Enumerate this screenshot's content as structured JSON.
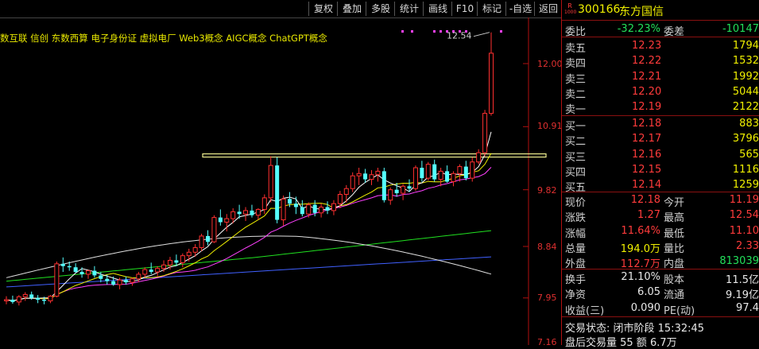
{
  "toolbar": {
    "buttons": [
      "复权",
      "叠加",
      "多股",
      "统计",
      "画线",
      "F10",
      "标记",
      "-自选",
      "返回"
    ]
  },
  "chart": {
    "concept_tags": "数互联 信创 东数西算 电子身份证 虚拟电厂 Web3概念 AIGC概念 ChatGPT概念",
    "high_marker": "12.54",
    "y_axis_labels": [
      "12.00",
      "10.91",
      "9.82",
      "8.84",
      "7.95",
      "7.16"
    ],
    "colors": {
      "up": "#ff3030",
      "down": "#54ffff",
      "ma5": "#ffffff",
      "ma10": "#f0f000",
      "ma20": "#ff40ff",
      "ma60": "#20e020",
      "ma120": "#4060ff",
      "ma250": "#e0e0e0",
      "hline": "#f0f090"
    },
    "candles": [
      [
        7.9,
        7.98,
        7.84,
        7.92
      ],
      [
        7.92,
        7.99,
        7.85,
        7.88
      ],
      [
        7.88,
        8.0,
        7.82,
        7.97
      ],
      [
        7.97,
        8.05,
        7.9,
        8.01
      ],
      [
        8.01,
        8.06,
        7.92,
        7.95
      ],
      [
        7.95,
        8.0,
        7.86,
        7.92
      ],
      [
        7.92,
        7.97,
        7.84,
        7.9
      ],
      [
        7.9,
        8.0,
        7.86,
        7.98
      ],
      [
        7.98,
        8.58,
        7.96,
        8.54
      ],
      [
        8.54,
        8.65,
        8.4,
        8.5
      ],
      [
        8.5,
        8.58,
        8.42,
        8.48
      ],
      [
        8.48,
        8.55,
        8.38,
        8.4
      ],
      [
        8.4,
        8.48,
        8.3,
        8.36
      ],
      [
        8.36,
        8.44,
        8.28,
        8.42
      ],
      [
        8.42,
        8.5,
        8.3,
        8.34
      ],
      [
        8.34,
        8.4,
        8.22,
        8.28
      ],
      [
        8.28,
        8.35,
        8.18,
        8.24
      ],
      [
        8.24,
        8.32,
        8.16,
        8.18
      ],
      [
        8.18,
        8.3,
        8.1,
        8.26
      ],
      [
        8.26,
        8.32,
        8.18,
        8.22
      ],
      [
        8.22,
        8.3,
        8.16,
        8.28
      ],
      [
        8.28,
        8.4,
        8.22,
        8.36
      ],
      [
        8.36,
        8.48,
        8.3,
        8.44
      ],
      [
        8.44,
        8.56,
        8.36,
        8.4
      ],
      [
        8.4,
        8.5,
        8.32,
        8.46
      ],
      [
        8.46,
        8.6,
        8.4,
        8.52
      ],
      [
        8.52,
        8.66,
        8.44,
        8.6
      ],
      [
        8.6,
        8.7,
        8.5,
        8.56
      ],
      [
        8.56,
        8.72,
        8.48,
        8.68
      ],
      [
        8.68,
        8.8,
        8.58,
        8.74
      ],
      [
        8.74,
        8.88,
        8.66,
        8.82
      ],
      [
        8.82,
        9.06,
        8.76,
        9.02
      ],
      [
        9.02,
        9.12,
        8.86,
        8.92
      ],
      [
        8.92,
        9.38,
        8.9,
        9.34
      ],
      [
        9.34,
        9.48,
        9.2,
        9.26
      ],
      [
        9.26,
        9.4,
        9.1,
        9.32
      ],
      [
        9.32,
        9.5,
        9.24,
        9.44
      ],
      [
        9.44,
        9.56,
        9.32,
        9.4
      ],
      [
        9.4,
        9.52,
        9.28,
        9.46
      ],
      [
        9.46,
        9.56,
        9.34,
        9.38
      ],
      [
        9.38,
        9.5,
        9.3,
        9.48
      ],
      [
        9.48,
        9.74,
        9.4,
        9.68
      ],
      [
        9.68,
        10.4,
        9.6,
        10.24
      ],
      [
        10.24,
        10.38,
        9.24,
        9.3
      ],
      [
        9.3,
        9.72,
        9.2,
        9.66
      ],
      [
        9.66,
        9.78,
        9.52,
        9.58
      ],
      [
        9.58,
        9.7,
        9.4,
        9.52
      ],
      [
        9.52,
        9.64,
        9.36,
        9.4
      ],
      [
        9.4,
        9.6,
        9.34,
        9.56
      ],
      [
        9.56,
        9.64,
        9.36,
        9.42
      ],
      [
        9.42,
        9.58,
        9.34,
        9.52
      ],
      [
        9.52,
        9.62,
        9.4,
        9.46
      ],
      [
        9.46,
        9.64,
        9.38,
        9.58
      ],
      [
        9.58,
        9.8,
        9.5,
        9.74
      ],
      [
        9.74,
        9.9,
        9.6,
        9.84
      ],
      [
        9.84,
        10.12,
        9.78,
        10.06
      ],
      [
        10.06,
        10.2,
        9.9,
        10.1
      ],
      [
        10.1,
        10.18,
        9.94,
        10.0
      ],
      [
        10.0,
        10.16,
        9.9,
        10.08
      ],
      [
        10.08,
        10.2,
        9.96,
        10.14
      ],
      [
        10.14,
        10.2,
        9.6,
        9.64
      ],
      [
        9.64,
        9.86,
        9.56,
        9.82
      ],
      [
        9.82,
        9.94,
        9.7,
        9.76
      ],
      [
        9.76,
        9.92,
        9.64,
        9.88
      ],
      [
        9.88,
        10.0,
        9.78,
        9.84
      ],
      [
        9.84,
        10.24,
        9.8,
        10.2
      ],
      [
        10.2,
        10.32,
        9.96,
        10.02
      ],
      [
        10.02,
        10.3,
        9.98,
        10.26
      ],
      [
        10.26,
        10.34,
        9.96,
        10.0
      ],
      [
        10.0,
        10.2,
        9.88,
        10.14
      ],
      [
        10.14,
        10.24,
        9.94,
        9.96
      ],
      [
        9.96,
        10.14,
        9.88,
        10.1
      ],
      [
        10.1,
        10.26,
        9.96,
        10.22
      ],
      [
        10.22,
        10.32,
        9.98,
        10.02
      ],
      [
        10.02,
        10.38,
        9.96,
        10.3
      ],
      [
        10.3,
        10.52,
        10.26,
        10.46
      ],
      [
        10.46,
        11.2,
        10.4,
        11.14
      ],
      [
        11.14,
        12.54,
        11.1,
        12.18
      ]
    ]
  },
  "panel": {
    "code": "300166",
    "name": "东方国信",
    "tag_top": "R",
    "tag_bottom": "1000",
    "weibi": {
      "label": "委比",
      "value": "-32.23%",
      "label2": "委差",
      "value2": "-10147"
    },
    "sells": [
      {
        "label": "卖五",
        "price": "12.23",
        "vol": "1794"
      },
      {
        "label": "卖四",
        "price": "12.22",
        "vol": "1532"
      },
      {
        "label": "卖三",
        "price": "12.21",
        "vol": "1992"
      },
      {
        "label": "卖二",
        "price": "12.20",
        "vol": "5044"
      },
      {
        "label": "卖一",
        "price": "12.19",
        "vol": "2122"
      }
    ],
    "buys": [
      {
        "label": "买一",
        "price": "12.18",
        "vol": "883"
      },
      {
        "label": "买二",
        "price": "12.17",
        "vol": "3796"
      },
      {
        "label": "买三",
        "price": "12.16",
        "vol": "565"
      },
      {
        "label": "买四",
        "price": "12.15",
        "vol": "1116"
      },
      {
        "label": "买五",
        "price": "12.14",
        "vol": "1259"
      }
    ],
    "quote": [
      {
        "l1": "现价",
        "v1": "12.18",
        "c1": "red",
        "l2": "今开",
        "v2": "11.19",
        "c2": "red"
      },
      {
        "l1": "涨跌",
        "v1": "1.27",
        "c1": "red",
        "l2": "最高",
        "v2": "12.54",
        "c2": "red"
      },
      {
        "l1": "涨幅",
        "v1": "11.64%",
        "c1": "red",
        "l2": "最低",
        "v2": "11.10",
        "c2": "red"
      },
      {
        "l1": "总量",
        "v1": "194.0万",
        "c1": "yellow",
        "l2": "量比",
        "v2": "2.33",
        "c2": "red"
      },
      {
        "l1": "外盘",
        "v1": "112.7万",
        "c1": "red",
        "l2": "内盘",
        "v2": "813039",
        "c2": "green"
      }
    ],
    "stats": [
      {
        "l1": "换手",
        "v1": "21.10%",
        "l2": "股本",
        "v2": "11.5亿"
      },
      {
        "l1": "净资",
        "v1": "6.05",
        "l2": "流通",
        "v2": "9.19亿"
      },
      {
        "l1": "收益(三)",
        "v1": "0.090",
        "l2": "PE(动)",
        "v2": "97.4"
      }
    ],
    "status": "交易状态: 闭市阶段 15:32:45",
    "afterhours": "盘后交易量 55 额 6.7万"
  }
}
